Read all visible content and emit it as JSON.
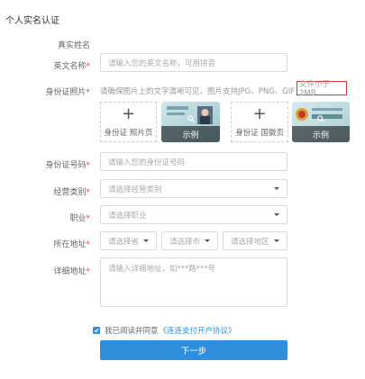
{
  "page": {
    "title": "个人实名认证"
  },
  "form": {
    "real_name": {
      "label": "真实姓名"
    },
    "english_name": {
      "label": "英文名称",
      "required_mark": "*",
      "placeholder": "请输入您的英文名称，可用拼音"
    },
    "id_photo": {
      "label": "身份证照片",
      "required_mark": "*",
      "hint": "请确保图片上的文字清晰可见，图片支持JPG、PNG、GIF，",
      "size_limit": "文件小于2MB",
      "front": {
        "upload_label": "身份证 照片页",
        "sample_label": "示例"
      },
      "back": {
        "upload_label": "身份证 国徽页",
        "sample_label": "示例"
      }
    },
    "id_number": {
      "label": "身份证号码",
      "required_mark": "*",
      "placeholder": "请输入您的身份证号码"
    },
    "business_type": {
      "label": "经营类别",
      "required_mark": "*",
      "selected": "请选择经营类别"
    },
    "occupation": {
      "label": "职业",
      "required_mark": "*",
      "selected": "请选择职业"
    },
    "address": {
      "label": "所在地址",
      "required_mark": "*",
      "province": "请选择省",
      "city": "请选择市",
      "district": "请选择地区"
    },
    "detail_address": {
      "label": "详细地址",
      "required_mark": "*",
      "placeholder": "请输入详细地址，如***路***号"
    },
    "agreement": {
      "text": "我已阅读并同意",
      "link": "《连连支付开户协议》",
      "checked": true
    },
    "next_button": "下一步"
  },
  "colors": {
    "accent": "#2f8fdc",
    "required": "#e64545",
    "highlight_box": "#d9343a"
  }
}
